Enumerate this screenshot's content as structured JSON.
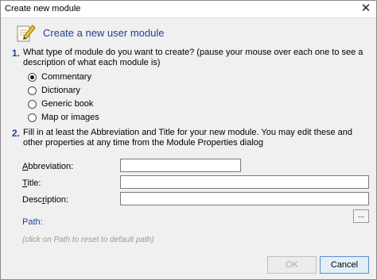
{
  "window": {
    "title": "Create new module",
    "close_glyph": "✕"
  },
  "header": {
    "icon": "pencil-note-icon",
    "text": "Create a new user module"
  },
  "step1": {
    "number": "1.",
    "text": "What type of module do you want to create? (pause your mouse over each one to see a description of what each module is)",
    "options": [
      {
        "label": "Commentary",
        "selected": true
      },
      {
        "label": "Dictionary",
        "selected": false
      },
      {
        "label": "Generic book",
        "selected": false
      },
      {
        "label": "Map or images",
        "selected": false
      }
    ]
  },
  "step2": {
    "number": "2.",
    "text": "Fill in at least the Abbreviation and Title for your new module. You may edit these and other properties at any time from the Module Properties dialog"
  },
  "fields": {
    "abbreviation": {
      "label_pre": "",
      "label_u": "A",
      "label_post": "bbreviation:",
      "value": ""
    },
    "title": {
      "label_pre": "",
      "label_u": "T",
      "label_post": "itle:",
      "value": ""
    },
    "description": {
      "label_pre": "Desc",
      "label_u": "r",
      "label_post": "iption:",
      "value": ""
    }
  },
  "path": {
    "label": "Path:",
    "browse_label": "...",
    "hint": "(click on Path to reset to default path)"
  },
  "buttons": {
    "ok": "OK",
    "cancel": "Cancel"
  },
  "colors": {
    "accent": "#1c3f9a",
    "hint": "#9a9a9a"
  }
}
